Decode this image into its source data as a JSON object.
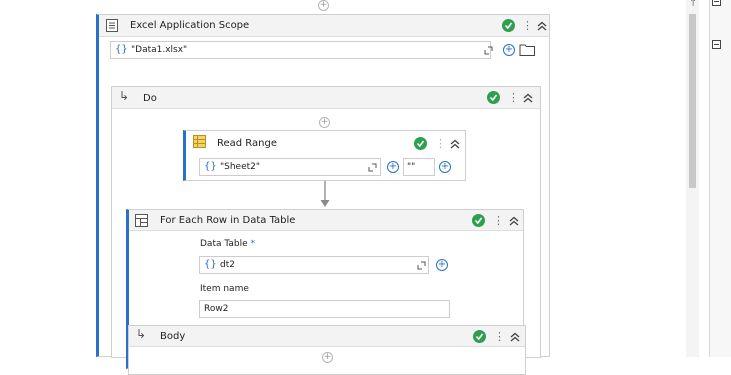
{
  "excel_scope": {
    "title": "Excel Application Scope",
    "workbook_path": "\"Data1.xlsx\""
  },
  "do_block": {
    "title": "Do"
  },
  "read_range": {
    "title": "Read Range",
    "sheet": "\"Sheet2\"",
    "range": "\"\""
  },
  "for_each": {
    "title": "For Each Row in Data Table",
    "data_table_label": "Data Table",
    "required_mark": "*",
    "data_table_value": "dt2",
    "item_name_label": "Item name",
    "item_name_value": "Row2"
  },
  "body_block": {
    "title": "Body"
  },
  "icons": {
    "brace": "{}",
    "plus": "+",
    "kebab": "⋮",
    "indent_arrow": "↳",
    "up_arrow": "↑"
  },
  "colors": {
    "success": "#2e9e4f",
    "accent": "#2a6fc9",
    "selected_bar": "#2a6fc9",
    "header_bg": "#f3f3f3"
  }
}
